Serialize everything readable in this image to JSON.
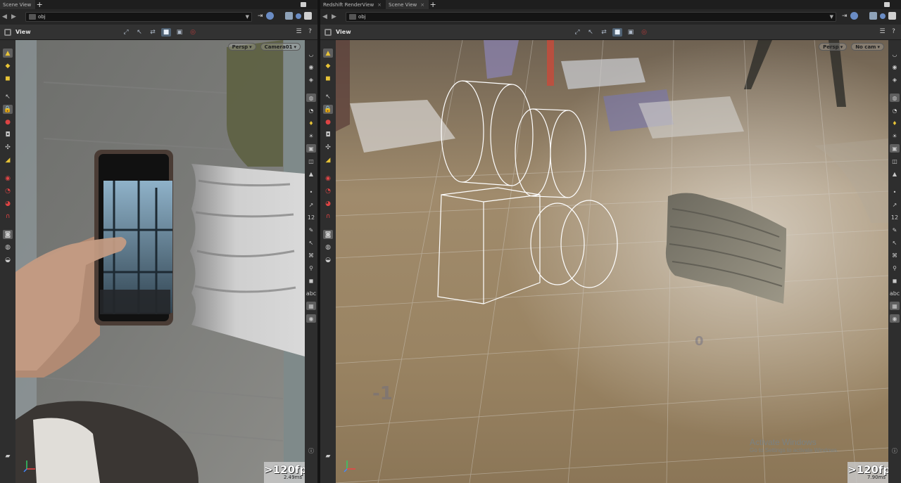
{
  "left_pane": {
    "tabs": [
      {
        "label": "Scene View",
        "active": true
      }
    ],
    "path": "obj",
    "view_label": "View",
    "projection": "Persp",
    "camera": "Camera01",
    "fps": ">120fps",
    "frame_time": "2.49ms",
    "viewport_content": "camera-background-phone-and-cloth"
  },
  "right_pane": {
    "tabs": [
      {
        "label": "Redshift RenderView",
        "active": false
      },
      {
        "label": "Scene View",
        "active": true
      }
    ],
    "path": "obj",
    "view_label": "View",
    "projection": "Persp",
    "camera": "No cam",
    "fps": ">120fps",
    "frame_time": "7.90ms",
    "grid_labels": [
      "-1",
      "0"
    ],
    "watermark": {
      "line1": "Activate Windows",
      "line2": "Go to Settings to activate Windows."
    }
  },
  "toolbar_icons": {
    "left": [
      "select-icon",
      "lock-icon",
      "magnet-icon",
      "snap-icon",
      "grid-snap-icon",
      "transform-icon",
      "pivot-icon",
      "handle-icon"
    ],
    "right": [
      "eye-icon",
      "light-icon",
      "camera-icon",
      "display-icon",
      "shading-icon",
      "abc-icon"
    ]
  },
  "colors": {
    "accent": "#506274",
    "fps_bg": "#c8c8c8",
    "floor": "#9a8463"
  }
}
